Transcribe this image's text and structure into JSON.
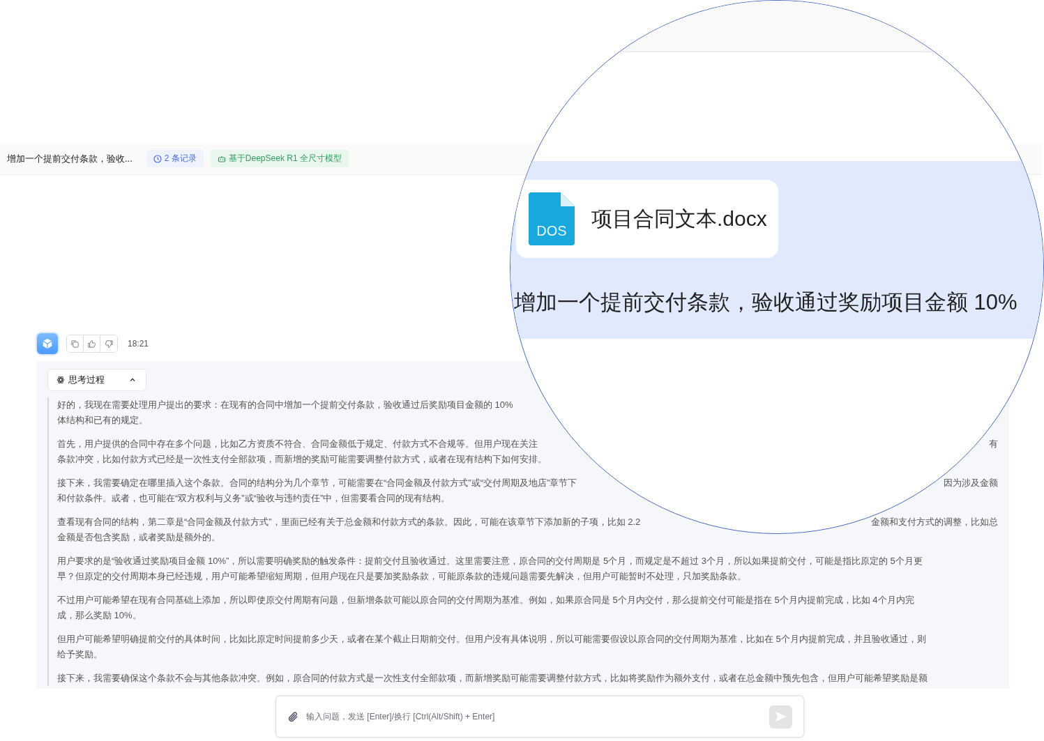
{
  "header": {
    "title": "增加一个提前交付条款，验收...",
    "tags": [
      {
        "kind": "records",
        "label": "2 条记录"
      },
      {
        "kind": "model",
        "label": "基于DeepSeek R1 全尺寸模型"
      }
    ]
  },
  "message": {
    "time": "18:21",
    "thinking": {
      "label": "思考过程",
      "expanded": true,
      "paragraphs": [
        {
          "lines": [
            {
              "left": "好的，我现在需要处理用户提出的要求：在现有的合同中增加一个提前交付条款，验收通过后奖励项目金额的 10%"
            },
            {
              "left": "体结构和已有的规定。"
            }
          ]
        },
        {
          "lines": [
            {
              "left": "首先，用户提供的合同中存在多个问题，比如乙方资质不符合、合同金额低于规定、付款方式不合规等。但用户现在关注",
              "right": "有"
            },
            {
              "left": "条款冲突，比如付款方式已经是一次性支付全部款项，而新增的奖励可能需要调整付款方式，或者在现有结构下如何安排。"
            }
          ]
        },
        {
          "lines": [
            {
              "left": "接下来，我需要确定在哪里插入这个条款。合同的结构分为几个章节，可能需要在“合同金额及付款方式”或“交付周期及地店”章节下",
              "right": "因为涉及金额"
            },
            {
              "left": "和付款条件。或者，也可能在“双方权利与义务”或“验收与违约责任”中，但需要看合同的现有结构。"
            }
          ]
        },
        {
          "lines": [
            {
              "left": "查看现有合同的结构，第二章是“合同金额及付款方式”，里面已经有关于总金额和付款方式的条款。因此，可能在该章节下添加新的子项，比如 2.2",
              "right": "金额和支付方式的调整，比如总"
            },
            {
              "left": "金额是否包含奖励，或者奖励是额外的。"
            }
          ]
        },
        {
          "lines": [
            {
              "left": "用户要求的是“验收通过奖励项目金额 10%”，所以需要明确奖励的触发条件：提前交付且验收通过。这里需要注意，原合同的交付周期是 5个月，而规定是不超过 3个月，所以如果提前交付，可能是指比原定的 5个月更"
            },
            {
              "left": "早？但原定的交付周期本身已经违规，用户可能希望缩短周期，但用户现在只是要加奖励条款，可能原条款的违规问题需要先解决，但用户可能暂时不处理，只加奖励条款。"
            }
          ]
        },
        {
          "lines": [
            {
              "left": "不过用户可能希望在现有合同基础上添加，所以即使原交付周期有问题，但新增条款可能以原合同的交付周期为基准。例如，如果原合同是 5个月内交付，那么提前交付可能是指在 5个月内提前完成，比如 4个月内完"
            },
            {
              "left": "成，那么奖励 10%。"
            }
          ]
        },
        {
          "lines": [
            {
              "left": "但用户可能希望明确提前交付的具体时间，比如比原定时间提前多少天，或者在某个截止日期前交付。但用户没有具体说明，所以可能需要假设以原合同的交付周期为基准，比如在 5个月内提前完成，并且验收通过，则"
            },
            {
              "left": "给予奖励。"
            }
          ]
        },
        {
          "lines": [
            {
              "left": "接下来，我需要确保这个条款不会与其他条款冲突。例如，原合同的付款方式是一次性支付全部款项，而新增奖励可能需要调整付款方式，比如将奖励作为额外支付，或者在总金额中预先包含，但用户可能希望奖励是额"
            }
          ]
        }
      ]
    }
  },
  "input": {
    "placeholder": "输入问题，发送 [Enter]/换行 [Ctrl(Alt/Shift) + Enter]"
  },
  "magnifier": {
    "attachment": {
      "name": "项目合同文本.docx",
      "icon_label": "DOS"
    },
    "text": "增加一个提前交付条款，验收通过奖励项目金额 10%"
  }
}
